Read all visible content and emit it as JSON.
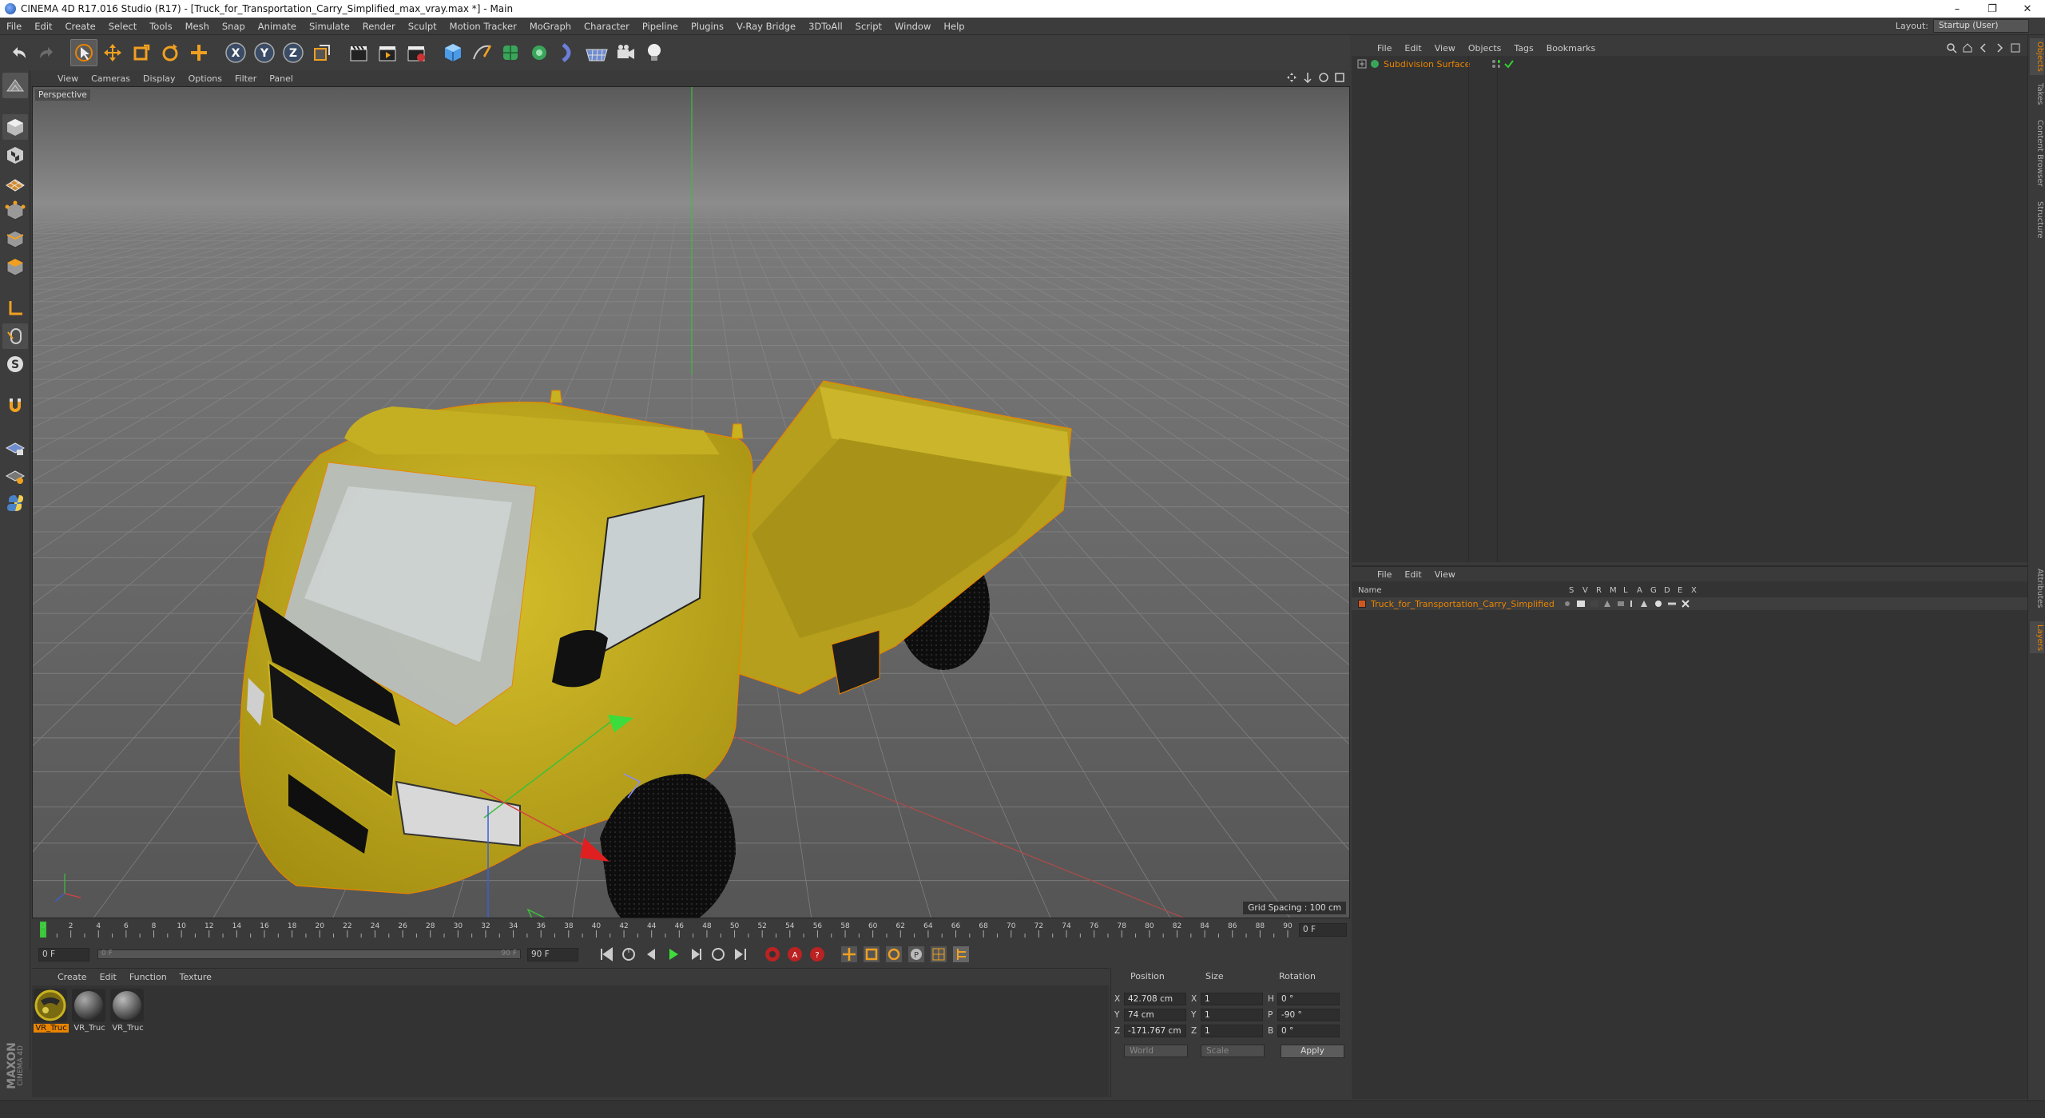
{
  "window": {
    "title": "CINEMA 4D R17.016 Studio (R17) - [Truck_for_Transportation_Carry_Simplified_max_vray.max *] - Main",
    "minimize": "–",
    "restore": "❐",
    "close": "✕"
  },
  "menubar": {
    "items": [
      "File",
      "Edit",
      "Create",
      "Select",
      "Tools",
      "Mesh",
      "Snap",
      "Animate",
      "Simulate",
      "Render",
      "Sculpt",
      "Motion Tracker",
      "MoGraph",
      "Character",
      "Pipeline",
      "Plugins",
      "V-Ray Bridge",
      "3DToAll",
      "Script",
      "Window",
      "Help"
    ],
    "layout_label": "Layout:",
    "layout_value": "Startup (User)"
  },
  "viewport": {
    "menu": [
      "View",
      "Cameras",
      "Display",
      "Options",
      "Filter",
      "Panel"
    ],
    "label": "Perspective",
    "grid_spacing": "Grid Spacing : 100 cm"
  },
  "timeline": {
    "ticks": [
      "0",
      "2",
      "4",
      "6",
      "8",
      "10",
      "12",
      "14",
      "16",
      "18",
      "20",
      "22",
      "24",
      "26",
      "28",
      "30",
      "32",
      "34",
      "36",
      "38",
      "40",
      "42",
      "44",
      "46",
      "48",
      "50",
      "52",
      "54",
      "56",
      "58",
      "60",
      "62",
      "64",
      "66",
      "68",
      "70",
      "72",
      "74",
      "76",
      "78",
      "80",
      "82",
      "84",
      "86",
      "88",
      "90"
    ],
    "current_frame": "0 F",
    "start_frame": "0 F",
    "range_start": "0 F",
    "range_end": "90 F",
    "end_frame": "90 F"
  },
  "materials": {
    "menu": [
      "Create",
      "Edit",
      "Function",
      "Texture"
    ],
    "items": [
      {
        "label": "VR_Truc",
        "selected": true
      },
      {
        "label": "VR_Truc",
        "selected": false
      },
      {
        "label": "VR_Truc",
        "selected": false
      }
    ]
  },
  "coords": {
    "headers": {
      "position": "Position",
      "size": "Size",
      "rotation": "Rotation"
    },
    "rows": [
      {
        "axis": "X",
        "pos": "42.708 cm",
        "size_axis": "X",
        "size": "1",
        "rot_axis": "H",
        "rot": "0 °"
      },
      {
        "axis": "Y",
        "pos": "74 cm",
        "size_axis": "Y",
        "size": "1",
        "rot_axis": "P",
        "rot": "-90 °"
      },
      {
        "axis": "Z",
        "pos": "-171.767 cm",
        "size_axis": "Z",
        "size": "1",
        "rot_axis": "B",
        "rot": "0 °"
      }
    ],
    "coord_system": "World",
    "mode": "Scale",
    "apply": "Apply"
  },
  "objects_panel": {
    "menu": [
      "File",
      "Edit",
      "View",
      "Objects",
      "Tags",
      "Bookmarks"
    ],
    "items": [
      {
        "name": "Subdivision Surface"
      }
    ]
  },
  "layers_panel": {
    "menu": [
      "File",
      "Edit",
      "View"
    ],
    "col_name": "Name",
    "col_flags": [
      "S",
      "V",
      "R",
      "M",
      "L",
      "A",
      "G",
      "D",
      "E",
      "X"
    ],
    "items": [
      {
        "name": "Truck_for_Transportation_Carry_Simplified"
      }
    ]
  },
  "right_tabs": {
    "top": [
      "Objects",
      "Takes",
      "Content Browser",
      "Structure"
    ],
    "bottom": [
      "Attributes",
      "Layers"
    ]
  },
  "logo": {
    "line1": "MAXON",
    "line2": "CINEMA 4D"
  },
  "colors": {
    "accent": "#e98400",
    "bg": "#3a3a3a",
    "viewport": "#5c5c5c",
    "truck": "#c9b21f"
  }
}
